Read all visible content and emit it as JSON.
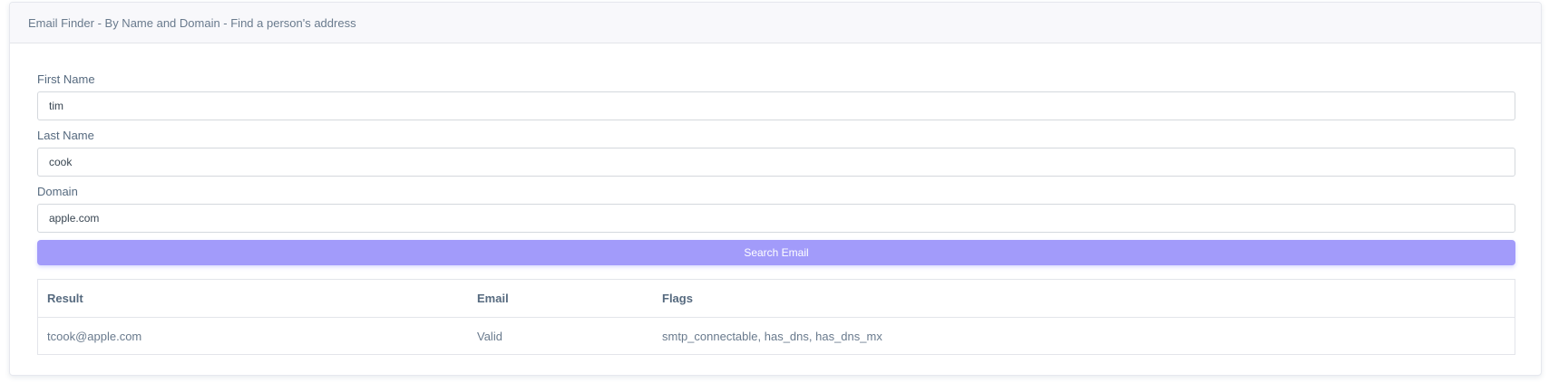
{
  "header": {
    "title": "Email Finder - By Name and Domain - Find a person's address"
  },
  "form": {
    "first_name": {
      "label": "First Name",
      "value": "tim"
    },
    "last_name": {
      "label": "Last Name",
      "value": "cook"
    },
    "domain": {
      "label": "Domain",
      "value": "apple.com"
    },
    "submit_label": "Search Email"
  },
  "results": {
    "columns": [
      "Result",
      "Email",
      "Flags"
    ],
    "rows": [
      [
        "tcook@apple.com",
        "Valid",
        "smtp_connectable, has_dns, has_dns_mx"
      ]
    ]
  },
  "colors": {
    "button": "#a29bfa",
    "header_bg": "#f8f8fb"
  }
}
